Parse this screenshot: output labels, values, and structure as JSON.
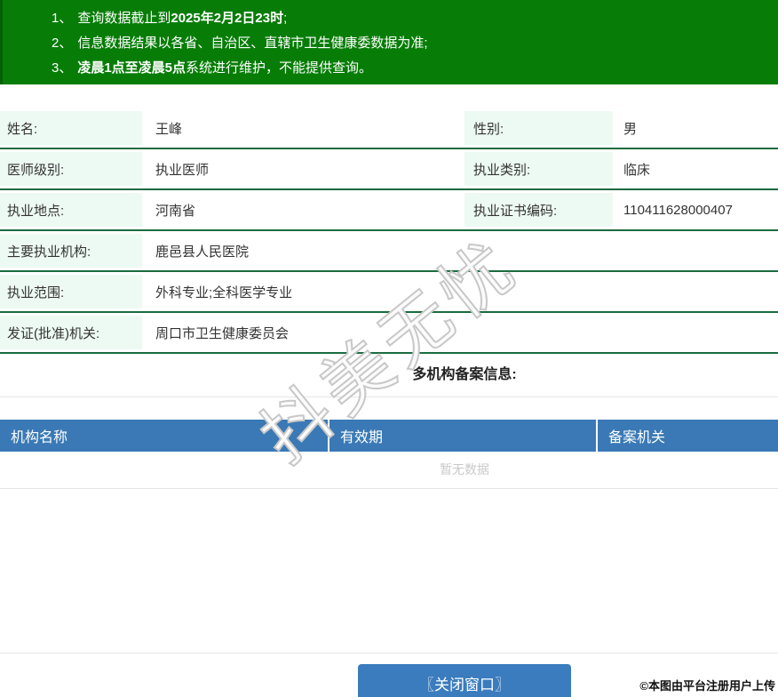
{
  "notice": {
    "lines": [
      {
        "num": "1、",
        "pre": "查询数据截止到",
        "bold": "2025年2月2日23时",
        "post": ";"
      },
      {
        "num": "2、",
        "pre": "信息数据结果以各省、自治区、直辖市卫生健康委数据为准;",
        "bold": "",
        "post": ""
      },
      {
        "num": "3、",
        "pre": "",
        "bold": "凌晨1点至凌晨5点",
        "post": "系统进行维护，不能提供查询。"
      }
    ]
  },
  "info": {
    "rows": [
      {
        "label": "姓名:",
        "value": "王峰",
        "label2": "性别:",
        "value2": "男"
      },
      {
        "label": "医师级别:",
        "value": "执业医师",
        "label2": "执业类别:",
        "value2": "临床"
      },
      {
        "label": "执业地点:",
        "value": "河南省",
        "label2": "执业证书编码:",
        "value2": "110411628000407"
      },
      {
        "label": "主要执业机构:",
        "value": "鹿邑县人民医院"
      },
      {
        "label": "执业范围:",
        "value": "外科专业;全科医学专业"
      },
      {
        "label": "发证(批准)机关:",
        "value": "周口市卫生健康委员会"
      }
    ]
  },
  "section": {
    "title": "多机构备案信息:"
  },
  "record_table": {
    "headers": [
      "机构名称",
      "有效期",
      "备案机关"
    ],
    "empty_text": "暂无数据",
    "rows": []
  },
  "watermark_text": "抖美无忧",
  "close_button_label": "〖关闭窗口〗",
  "copyright_text": "©本图由平台注册用户上传",
  "colors": {
    "banner_green": "#077d07",
    "banner_green_dark": "#046004",
    "row_line_green": "#1a6b40",
    "label_bg_mint": "#edfaf3",
    "table_header_blue": "#3a79b5",
    "button_blue": "#3a7cbd",
    "empty_text_gray": "#c9c9c9",
    "divider_gray": "#e5e5e5"
  }
}
